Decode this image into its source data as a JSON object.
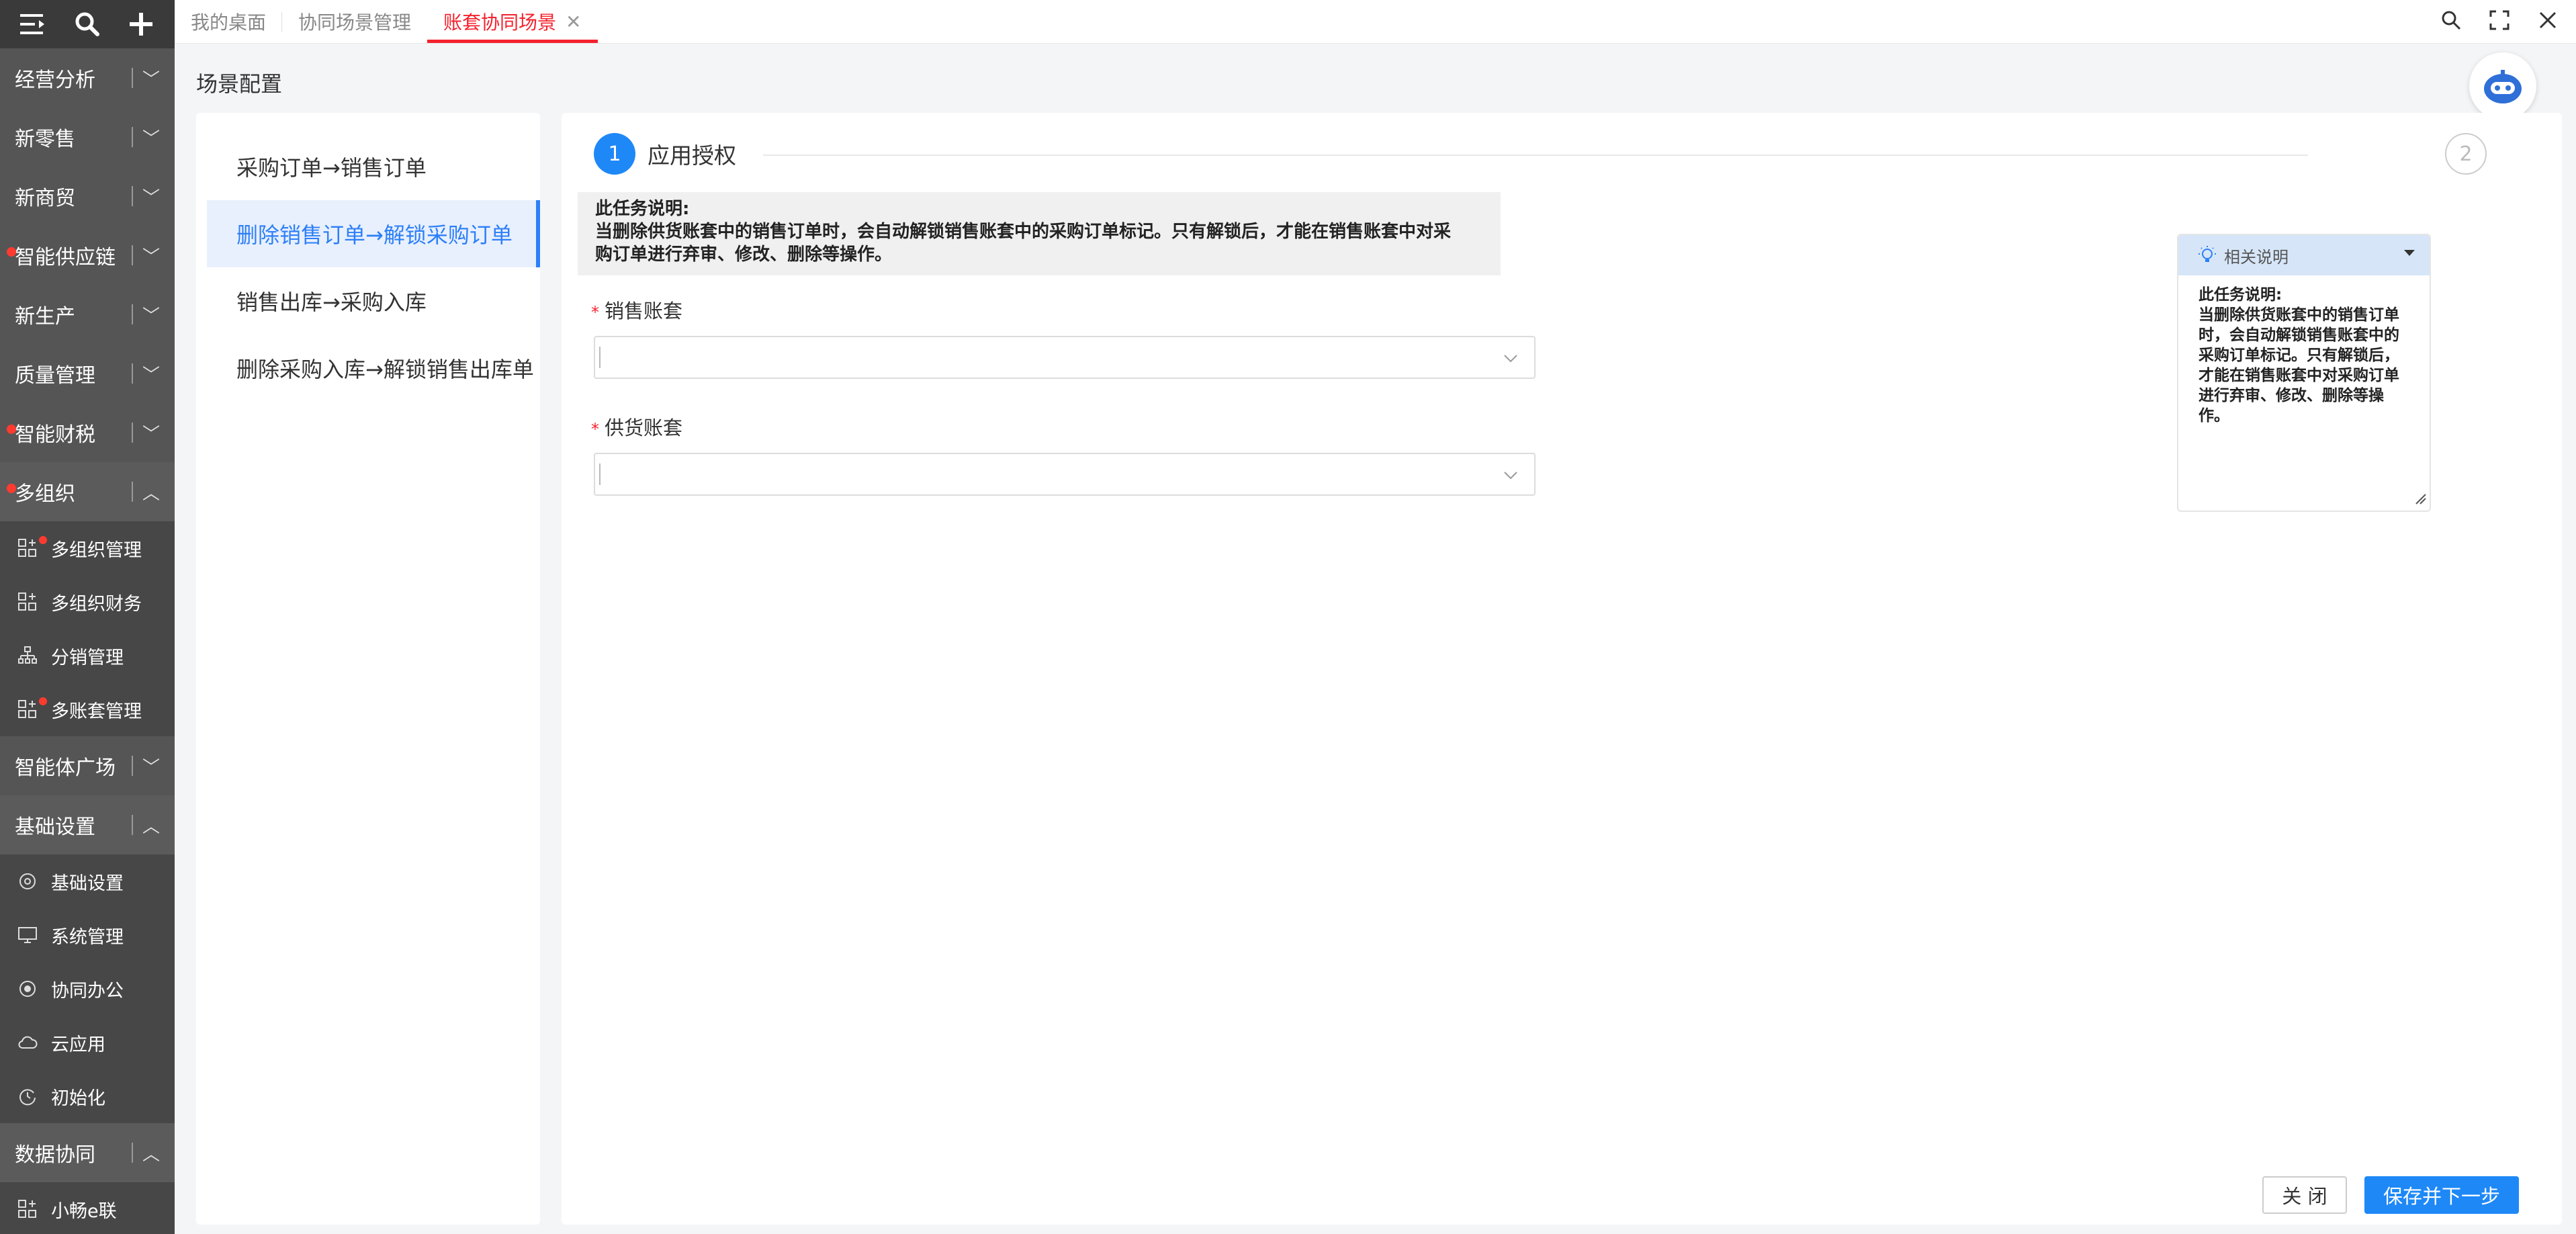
{
  "sidebar": {
    "groups_top": [
      {
        "label": "经营分析",
        "dot": false
      },
      {
        "label": "新零售",
        "dot": false
      },
      {
        "label": "新商贸",
        "dot": false
      },
      {
        "label": "智能供应链",
        "dot": true
      },
      {
        "label": "新生产",
        "dot": false
      },
      {
        "label": "质量管理",
        "dot": false
      },
      {
        "label": "智能财税",
        "dot": true
      },
      {
        "label": "多组织",
        "dot": true
      }
    ],
    "multi_org_items": [
      {
        "label": "多组织管理",
        "dot": true
      },
      {
        "label": "多组织财务",
        "dot": false
      },
      {
        "label": "分销管理",
        "dot": false
      },
      {
        "label": "多账套管理",
        "dot": true
      }
    ],
    "agent_group": "智能体广场",
    "basic_group": "基础设置",
    "basic_items": [
      {
        "label": "基础设置"
      },
      {
        "label": "系统管理"
      },
      {
        "label": "协同办公"
      },
      {
        "label": "云应用"
      },
      {
        "label": "初始化"
      }
    ],
    "data_group": "数据协同",
    "data_items": [
      {
        "label": "小畅e联"
      }
    ]
  },
  "tabs": [
    {
      "label": "我的桌面"
    },
    {
      "label": "协同场景管理"
    },
    {
      "label": "账套协同场景",
      "active": true
    }
  ],
  "page_title": "场景配置",
  "scenes": [
    "采购订单→销售订单",
    "删除销售订单→解锁采购订单",
    "销售出库→采购入库",
    "删除采购入库→解锁销售出库单"
  ],
  "steps": {
    "step1_num": "1",
    "step1_label": "应用授权",
    "step2_num": "2"
  },
  "note": {
    "title": "此任务说明:",
    "line1": "当删除供货账套中的销售订单时，会自动解锁销售账套中的采购订单标记。只有解锁后，才能在销售账套中对采",
    "line2": "购订单进行弃审、修改、删除等操作。"
  },
  "form": {
    "sales_label": "销售账套",
    "supply_label": "供货账套",
    "required_mark": "*"
  },
  "help": {
    "title": "相关说明",
    "lines": [
      "此任务说明:",
      "当删除供货账套中的销售订单",
      "时，会自动解锁销售账套中的",
      "采购订单标记。只有解锁后，",
      "才能在销售账套中对采购订单",
      "进行弃审、修改、删除等操",
      "作。"
    ]
  },
  "buttons": {
    "close": "关 闭",
    "next": "保存并下一步"
  },
  "colors": {
    "accent": "#1e88f7",
    "active_tab": "#f5222d",
    "sidebar": "#4b4b4b"
  }
}
